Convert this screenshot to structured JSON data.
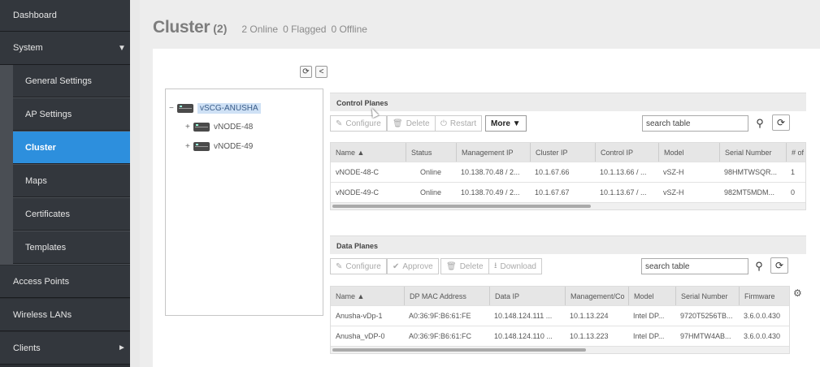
{
  "sidebar": {
    "items": [
      {
        "label": "Dashboard"
      },
      {
        "label": "System",
        "arrow": "▼"
      },
      {
        "label": "Access Points"
      },
      {
        "label": "Wireless LANs"
      },
      {
        "label": "Clients",
        "arrow": "►"
      }
    ],
    "system_sub": [
      {
        "label": "General Settings"
      },
      {
        "label": "AP Settings"
      },
      {
        "label": "Cluster",
        "active": true
      },
      {
        "label": "Maps"
      },
      {
        "label": "Certificates"
      },
      {
        "label": "Templates"
      }
    ]
  },
  "page": {
    "title": "Cluster",
    "count": "(2)",
    "online": "2 Online",
    "flagged": "0 Flagged",
    "offline": "0 Offline"
  },
  "tree": {
    "root": "vSCG-ANUSHA",
    "children": [
      "vNODE-48",
      "vNODE-49"
    ]
  },
  "control_planes": {
    "title": "Control Planes",
    "buttons": {
      "configure": "Configure",
      "delete": "Delete",
      "restart": "Restart",
      "more": "More ▼"
    },
    "search_placeholder": "search table",
    "columns": [
      "Name ▲",
      "Status",
      "Management IP",
      "Cluster IP",
      "Control IP",
      "Model",
      "Serial Number",
      "# of"
    ],
    "rows": [
      [
        "vNODE-48-C",
        "Online",
        "10.138.70.48 / 2...",
        "10.1.67.66",
        "10.1.13.66 / ...",
        "vSZ-H",
        "98HMTWSQR...",
        "1"
      ],
      [
        "vNODE-49-C",
        "Online",
        "10.138.70.49 / 2...",
        "10.1.67.67",
        "10.1.13.67 / ...",
        "vSZ-H",
        "982MT5MDM...",
        "0"
      ]
    ]
  },
  "data_planes": {
    "title": "Data Planes",
    "buttons": {
      "configure": "Configure",
      "approve": "Approve",
      "delete": "Delete",
      "download": "Download"
    },
    "search_placeholder": "search table",
    "columns": [
      "Name ▲",
      "DP MAC Address",
      "Data IP",
      "Management/Co",
      "Model",
      "Serial Number",
      "Firmware"
    ],
    "rows": [
      [
        "Anusha-vDp-1",
        "A0:36:9F:B6:61:FE",
        "10.148.124.111 ...",
        "10.1.13.224",
        "Intel DP...",
        "9720T5256TB...",
        "3.6.0.0.430"
      ],
      [
        "Anusha_vDP-0",
        "A0:36:9F:B6:61:FC",
        "10.148.124.110 ...",
        "10.1.13.223",
        "Intel DP...",
        "97HMTW4AB...",
        "3.6.0.0.430"
      ]
    ]
  }
}
